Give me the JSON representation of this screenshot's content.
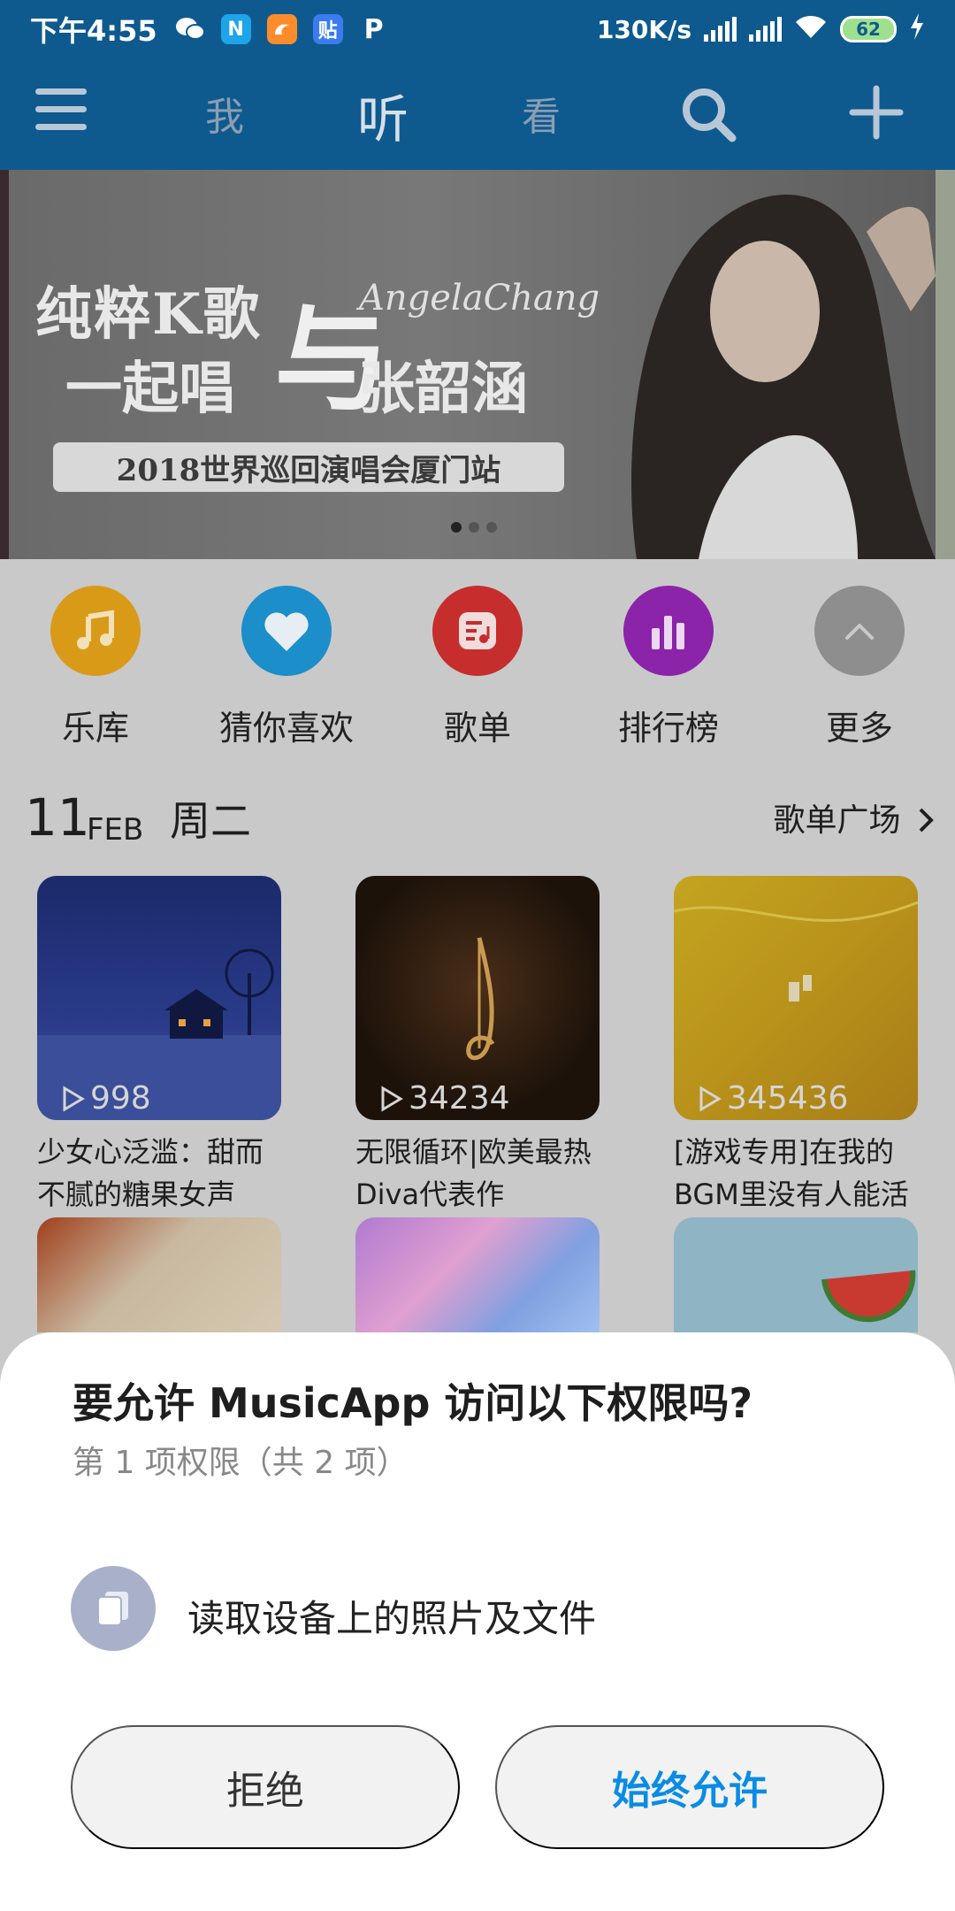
{
  "status_bar": {
    "time": "下午4:55",
    "apps": [
      {
        "name": "wechat-icon",
        "glyph": "",
        "color": "#ffffff"
      },
      {
        "name": "n-app-icon",
        "glyph": "N",
        "color": "#1ea4e8"
      },
      {
        "name": "uc-browser-icon",
        "glyph": "",
        "color": "#ff8c2b"
      },
      {
        "name": "tieba-icon",
        "glyph": "贴",
        "color": "#3a7cf0"
      },
      {
        "name": "p-app-icon",
        "glyph": "P",
        "color": "#0e5a8f"
      }
    ],
    "speed": "130K/s",
    "battery": "62"
  },
  "app_bar": {
    "tab_me": "我",
    "tab_listen": "听",
    "tab_watch": "看"
  },
  "banner": {
    "line1": "纯粹K歌",
    "line2": "一起唱",
    "yu": "与",
    "name": "张韶涵",
    "script": "AngelaChang",
    "pill": "2018世界巡回演唱会厦门站",
    "dots": 3,
    "active_dot": 0
  },
  "shortcuts": [
    {
      "label": "乐库",
      "color": "#d99a18",
      "icon": "music-note-icon"
    },
    {
      "label": "猜你喜欢",
      "color": "#1c8ec9",
      "icon": "heart-icon"
    },
    {
      "label": "歌单",
      "color": "#c62d2d",
      "icon": "playlist-icon"
    },
    {
      "label": "排行榜",
      "color": "#8b24a8",
      "icon": "chart-icon"
    },
    {
      "label": "更多",
      "color": "#8e8e8e",
      "icon": "chevron-up-icon"
    }
  ],
  "section": {
    "day": "11",
    "month": "FEB",
    "weekday": "周二",
    "link": "歌单广场"
  },
  "playlists": [
    {
      "plays": "998",
      "title": "少女心泛滥：甜而不腻的糖果女声",
      "bg": "#1a2a6a"
    },
    {
      "plays": "34234",
      "title": "无限循环|欧美最热Diva代表作",
      "bg": "#2c1a10"
    },
    {
      "plays": "345436",
      "title": "[游戏专用]在我的BGM里没有人能活",
      "bg": "#b8981a"
    }
  ],
  "playlists_row2": [
    {
      "bg": "#b0502a"
    },
    {
      "bg": "#9a7ad0"
    },
    {
      "bg": "#8fb4c4"
    }
  ],
  "dialog": {
    "title": "要允许 MusicApp 访问以下权限吗?",
    "subtitle": "第 1 项权限（共 2 项）",
    "permission": "读取设备上的照片及文件",
    "deny": "拒绝",
    "allow": "始终允许"
  }
}
